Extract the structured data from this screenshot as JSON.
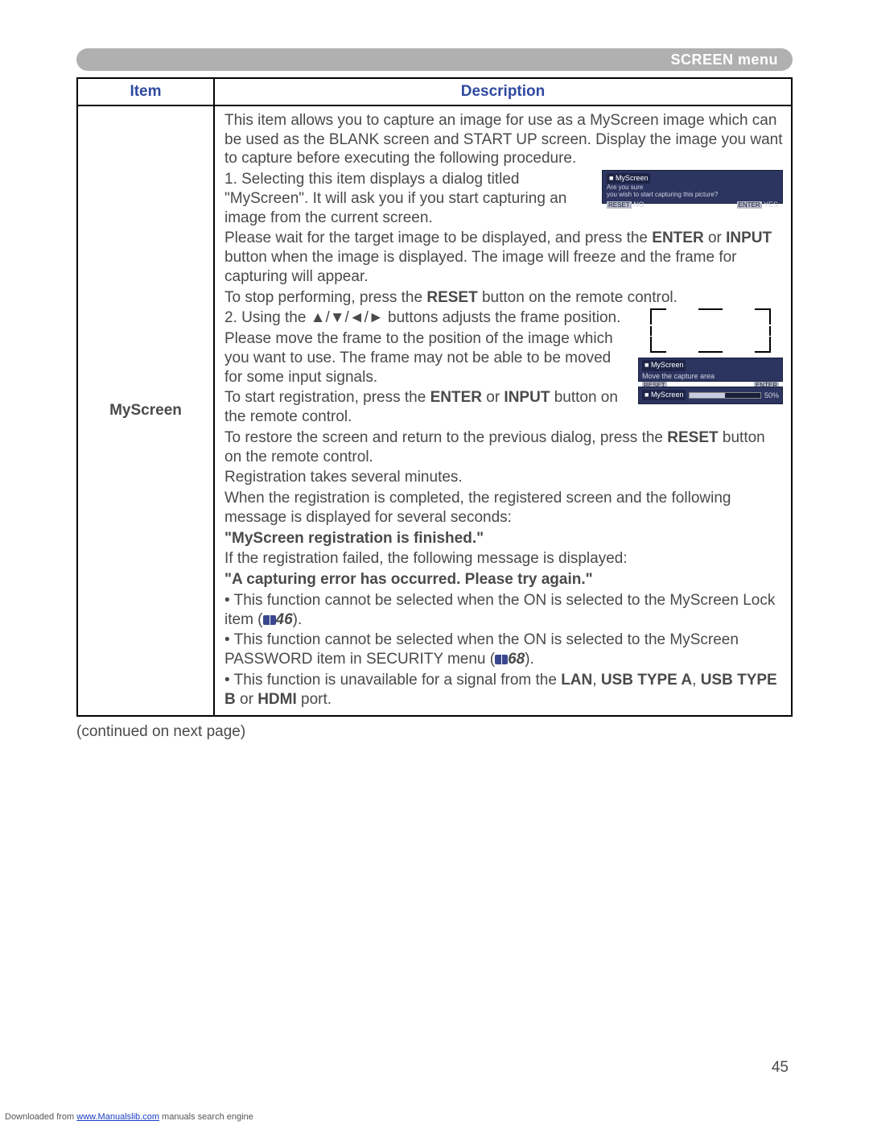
{
  "header": {
    "title": "SCREEN menu"
  },
  "table": {
    "col_item": "Item",
    "col_desc": "Description",
    "row": {
      "item": "MyScreen",
      "intro": "This item allows you to capture an image for use as a MyScreen image which can be used as the BLANK screen and START UP screen. Display the image you want to capture before executing the following procedure.",
      "s1a": "1. Selecting this item displays a dialog titled \"MyScreen\". It will ask you if you start capturing an image from the current screen.",
      "shot1": {
        "title": "MyScreen",
        "line1": "Are you sure",
        "line2": "you wish to start capturing this picture?",
        "reset": "RESET",
        "no_hint": "NO",
        "enter": "ENTER",
        "yes_hint": "YES"
      },
      "s1b_pre": "Please wait for the target image to be displayed, and press the ",
      "enter": "ENTER",
      "or1": " or ",
      "input": "INPUT",
      "s1b_post": " button when the image is displayed. The image will freeze and the frame for capturing will appear.",
      "s1c_pre": "To stop performing, press the ",
      "reset": "RESET",
      "s1c_post": " button on the remote control.",
      "s2a_pre": "2. Using the ",
      "arrows": "▲/▼/◄/►",
      "s2a_post": " buttons adjusts the frame position.",
      "s2b": "Please move the frame to the position of the image which you want to use. The frame may not be able to be moved for some input signals.",
      "shot2": {
        "title": "MyScreen",
        "line": "Move the capture area",
        "reset": "RESET",
        "enter": "ENTER"
      },
      "shot3": {
        "title": "MyScreen",
        "percent": "50%"
      },
      "s2c_pre": "To start registration, press the ",
      "s2c_mid": " or ",
      "s2c_post": " button on the remote control.",
      "s2d_pre": "To restore the screen and return to the previous dialog, press the ",
      "s2d_post": " button on the remote control.",
      "s2e": "Registration takes several minutes.",
      "s2f": "When the registration is completed, the registered screen and the following message is displayed for several seconds:",
      "msg1": "\"MyScreen registration is finished.\"",
      "s2g": "If the registration failed, the following message is displayed:",
      "msg2": "\"A capturing error has occurred. Please try again.\"",
      "note1a": "• This function cannot be selected when the ON is selected to the MyScreen Lock item (",
      "ref1": "46",
      "note1b": ").",
      "note2a": "• This function cannot be selected when the ON is selected to the MyScreen PASSWORD item in SECURITY menu (",
      "ref2": "68",
      "note2b": ").",
      "note3a": "• This function is unavailable for a signal from the ",
      "lan": "LAN",
      "c1": ", ",
      "usba": "USB TYPE A",
      "c2": ", ",
      "usbb": "USB TYPE B",
      "or2": " or ",
      "hdmi": "HDMI",
      "note3b": " port."
    }
  },
  "continued": "(continued on next page)",
  "page_num": "45",
  "footer": {
    "pre": "Downloaded from ",
    "link": "www.Manualslib.com",
    "post": " manuals search engine"
  }
}
